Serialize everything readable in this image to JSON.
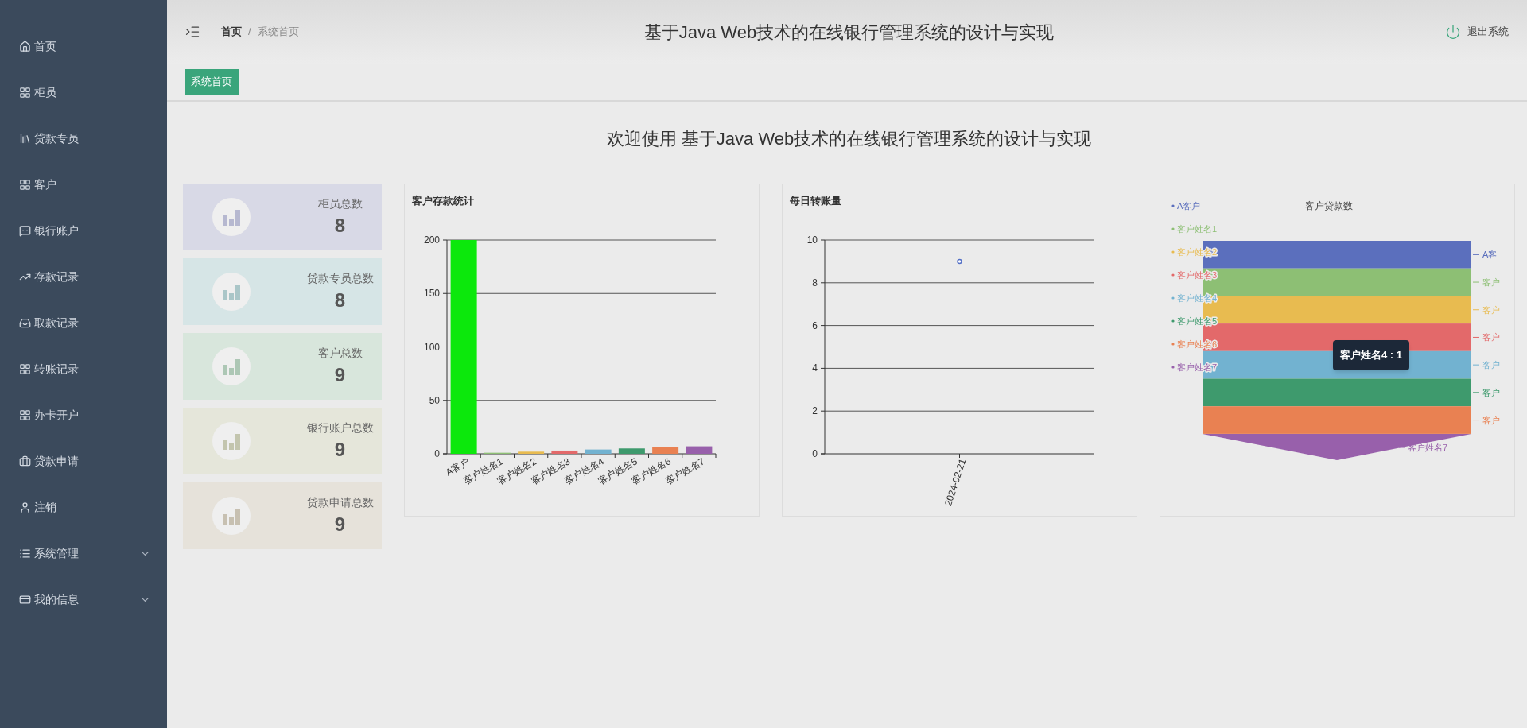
{
  "sidebar": {
    "items": [
      {
        "label": "首页",
        "kind": "link"
      },
      {
        "label": "柜员",
        "kind": "link"
      },
      {
        "label": "贷款专员",
        "kind": "link"
      },
      {
        "label": "客户",
        "kind": "link"
      },
      {
        "label": "银行账户",
        "kind": "link"
      },
      {
        "label": "存款记录",
        "kind": "link"
      },
      {
        "label": "取款记录",
        "kind": "link"
      },
      {
        "label": "转账记录",
        "kind": "link"
      },
      {
        "label": "办卡开户",
        "kind": "link"
      },
      {
        "label": "贷款申请",
        "kind": "link"
      },
      {
        "label": "注销",
        "kind": "link"
      },
      {
        "label": "系统管理",
        "kind": "group"
      },
      {
        "label": "我的信息",
        "kind": "group"
      }
    ]
  },
  "header": {
    "breadcrumb": [
      {
        "label": "首页",
        "current": false
      },
      {
        "label": "系统首页",
        "current": true
      }
    ],
    "separator": "/",
    "title": "基于Java Web技术的在线银行管理系统的设计与实现",
    "logout": "退出系统"
  },
  "tabs": [
    {
      "label": "系统首页",
      "selected": true
    }
  ],
  "welcome": "欢迎使用 基于Java Web技术的在线银行管理系统的设计与实现",
  "stats": [
    {
      "label": "柜员总数",
      "value": "8",
      "color": "#d8d9e6"
    },
    {
      "label": "贷款专员总数",
      "value": "8",
      "color": "#d6e5e6"
    },
    {
      "label": "客户总数",
      "value": "9",
      "color": "#d8e6dc"
    },
    {
      "label": "银行账户总数",
      "value": "9",
      "color": "#e5e6da"
    },
    {
      "label": "贷款申请总数",
      "value": "9",
      "color": "#e6e2da"
    }
  ],
  "deposits": {
    "chart_data": {
      "type": "bar",
      "title": "客户存款统计",
      "categories": [
        "A客户",
        "客户姓名1",
        "客户姓名2",
        "客户姓名3",
        "客户姓名4",
        "客户姓名5",
        "客户姓名6",
        "客户姓名7"
      ],
      "series": [
        {
          "color": "#0ce80c",
          "values": [
            200,
            null,
            null,
            null,
            null,
            null,
            null,
            null
          ]
        },
        {
          "color": "#8dbf74",
          "values": [
            null,
            1,
            null,
            null,
            null,
            null,
            null,
            null
          ]
        },
        {
          "color": "#e8bb50",
          "values": [
            null,
            null,
            2,
            null,
            null,
            null,
            null,
            null
          ]
        },
        {
          "color": "#e3696a",
          "values": [
            null,
            null,
            null,
            3,
            null,
            null,
            null,
            null
          ]
        },
        {
          "color": "#72b2d0",
          "values": [
            null,
            null,
            null,
            null,
            4,
            null,
            null,
            null
          ]
        },
        {
          "color": "#3e9a6d",
          "values": [
            null,
            null,
            null,
            null,
            null,
            5,
            null,
            null
          ]
        },
        {
          "color": "#e98152",
          "values": [
            null,
            null,
            null,
            null,
            null,
            null,
            6,
            null
          ]
        },
        {
          "color": "#9860ab",
          "values": [
            null,
            null,
            null,
            null,
            null,
            null,
            null,
            7
          ]
        }
      ],
      "stacked": true,
      "grid": true,
      "ylim": [
        0,
        200
      ],
      "yticks": [
        0,
        50,
        100,
        150,
        200
      ]
    }
  },
  "transfers": {
    "chart_data": {
      "type": "line",
      "title": "每日转账量",
      "categories": [
        "2024-02-21"
      ],
      "series": [
        {
          "color": "#5470c6",
          "values": [
            9
          ],
          "marker": true
        }
      ],
      "grid": true,
      "ylim": [
        0,
        10
      ],
      "yticks": [
        0,
        2,
        4,
        6,
        8,
        10
      ]
    }
  },
  "loans": {
    "title": "客户贷款数",
    "legend": [
      {
        "label": "A客户",
        "color": "#5b6fbd"
      },
      {
        "label": "客户姓名1",
        "color": "#8dbf74"
      },
      {
        "label": "客户姓名2",
        "color": "#e8bb50"
      },
      {
        "label": "客户姓名3",
        "color": "#e3696a"
      },
      {
        "label": "客户姓名4",
        "color": "#72b2d0"
      },
      {
        "label": "客户姓名5",
        "color": "#3e9a6d"
      },
      {
        "label": "客户姓名6",
        "color": "#e98152"
      },
      {
        "label": "客户姓名7",
        "color": "#9860ab"
      }
    ],
    "segment_labels": [
      "A客",
      "客户",
      "客户",
      "客户",
      "客户",
      "客户",
      "客户",
      "客户姓名7"
    ],
    "tooltip": "客户姓名4 : 1"
  }
}
